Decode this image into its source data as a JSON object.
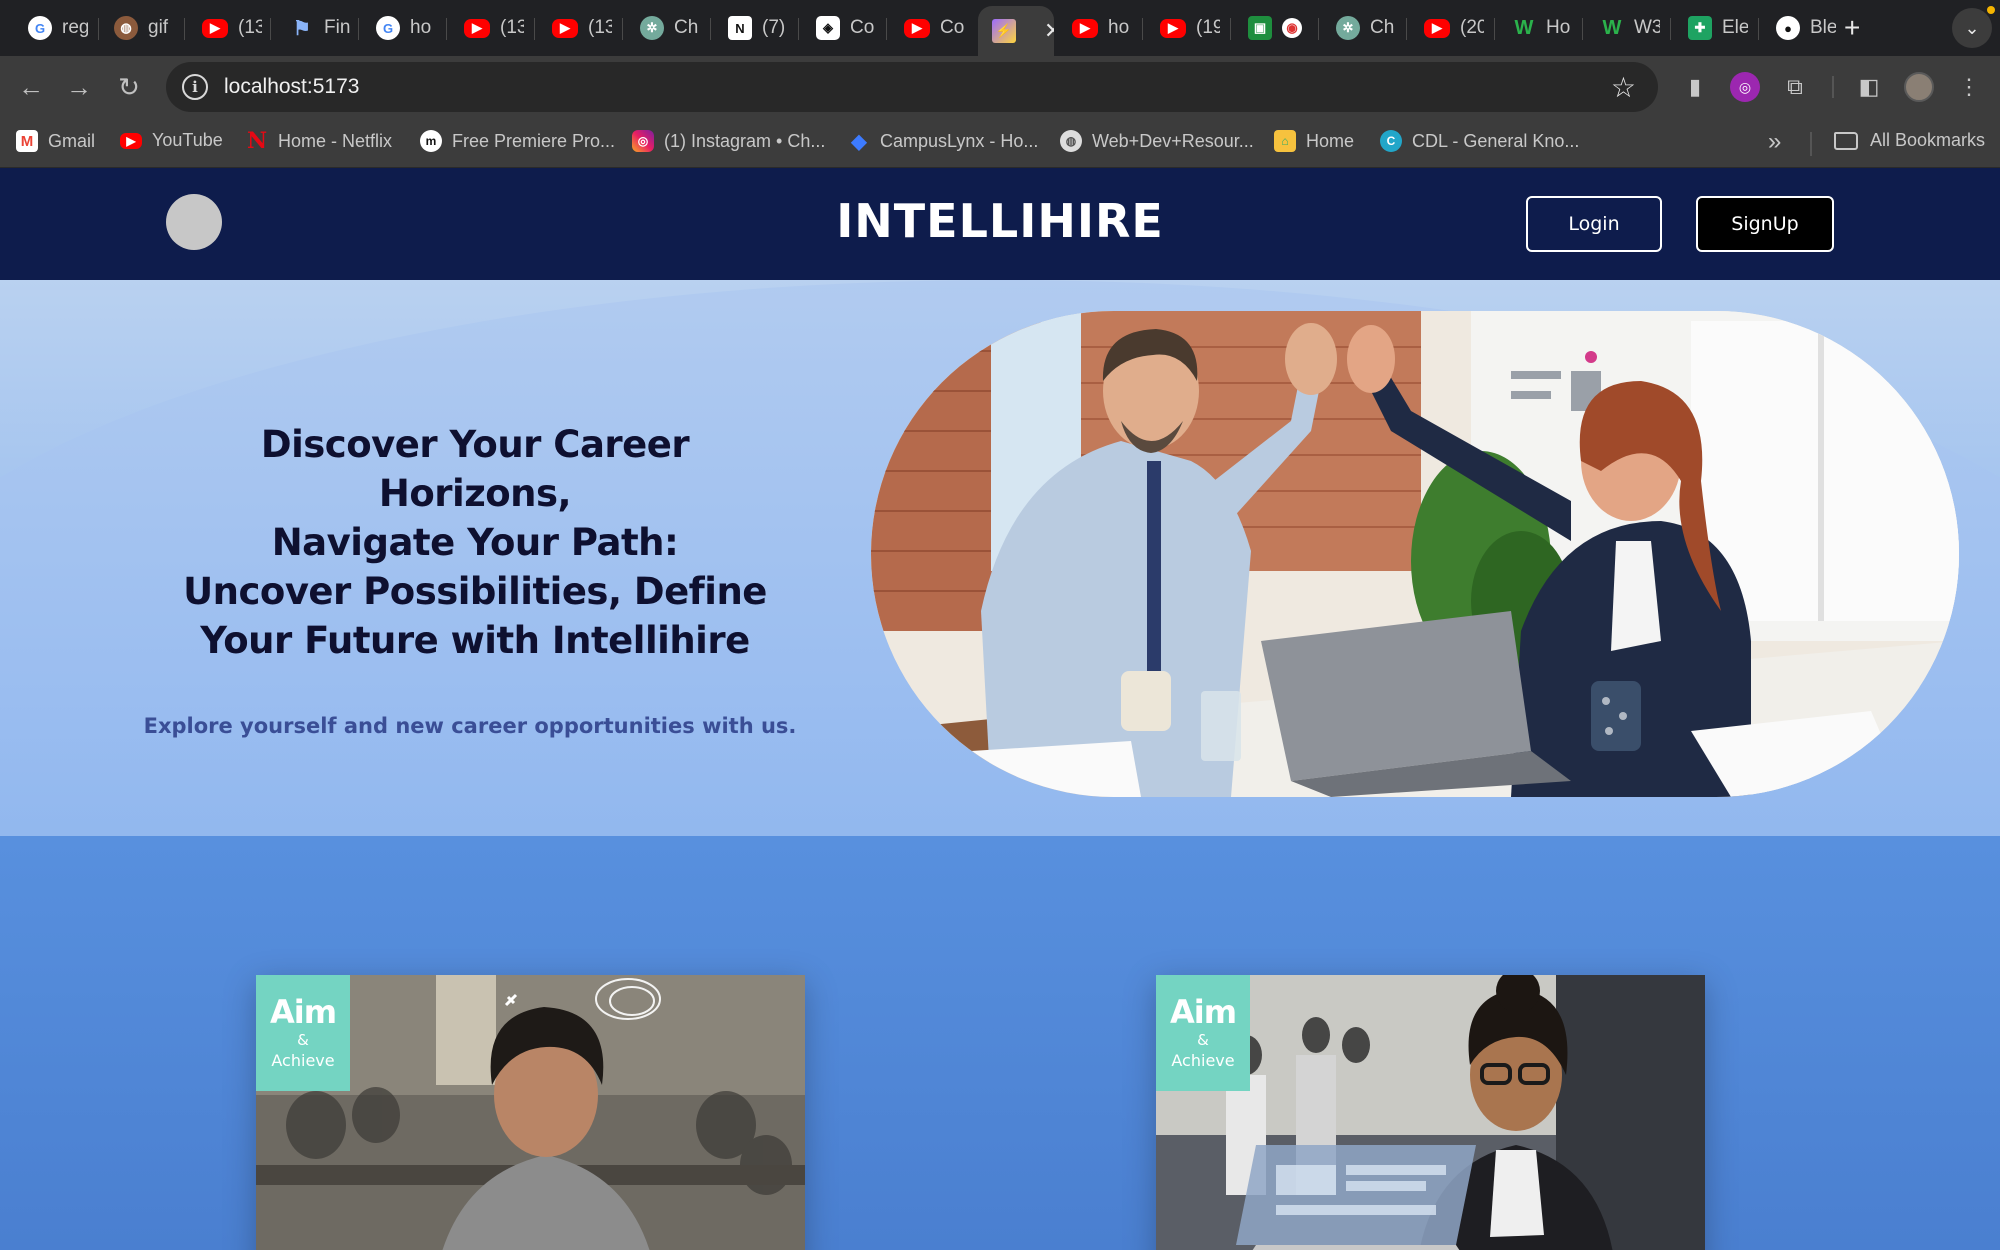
{
  "browser": {
    "tabs": [
      {
        "icon": "google-icon",
        "title": "reg"
      },
      {
        "icon": "globe-icon",
        "title": "gif"
      },
      {
        "icon": "youtube-icon",
        "title": "(13"
      },
      {
        "icon": "flag-icon",
        "title": "Fin"
      },
      {
        "icon": "google-icon",
        "title": "ho"
      },
      {
        "icon": "youtube-icon",
        "title": "(13"
      },
      {
        "icon": "youtube-icon",
        "title": "(13"
      },
      {
        "icon": "chatgpt-icon",
        "title": "Ch"
      },
      {
        "icon": "notion-icon",
        "title": "(7)"
      },
      {
        "icon": "codepen-icon",
        "title": "Co"
      },
      {
        "icon": "youtube-icon",
        "title": "Co"
      },
      {
        "icon": "vite-icon",
        "title": "",
        "active": true
      },
      {
        "icon": "youtube-icon",
        "title": "ho"
      },
      {
        "icon": "youtube-icon",
        "title": "(19"
      },
      {
        "icon": "meet-icon",
        "title": ""
      },
      {
        "icon": "chatgpt-icon",
        "title": "Ch"
      },
      {
        "icon": "youtube-icon",
        "title": "(20"
      },
      {
        "icon": "w3-icon",
        "title": "Ho"
      },
      {
        "icon": "w3-icon",
        "title": "W3"
      },
      {
        "icon": "sheets-icon",
        "title": "Ele"
      },
      {
        "icon": "medium-icon",
        "title": "Ble"
      }
    ],
    "address": "localhost:5173",
    "bookmarks": [
      {
        "icon": "gmail-icon",
        "label": "Gmail"
      },
      {
        "icon": "youtube-icon",
        "label": "YouTube"
      },
      {
        "icon": "netflix-icon",
        "label": "Home - Netflix"
      },
      {
        "icon": "m-icon",
        "label": "Free Premiere Pro..."
      },
      {
        "icon": "instagram-icon",
        "label": "(1) Instagram • Ch..."
      },
      {
        "icon": "campuslynx-icon",
        "label": "CampusLynx - Ho..."
      },
      {
        "icon": "globe-icon",
        "label": "Web+Dev+Resour..."
      },
      {
        "icon": "home-icon",
        "label": "Home"
      },
      {
        "icon": "cdl-icon",
        "label": "CDL - General Kno..."
      }
    ],
    "all_bookmarks": "All Bookmarks",
    "more_chevrons": "»"
  },
  "site": {
    "title": "INTELLIHIRE",
    "login_label": "Login",
    "signup_label": "SignUp",
    "hero": {
      "heading_lines": [
        "Discover Your Career Horizons,",
        "Navigate Your Path:",
        "Uncover Possibilities, Define",
        "Your Future with Intellihire"
      ],
      "subheading": "Explore yourself and new career opportunities with us."
    },
    "cards": [
      {
        "badge_title": "Aim",
        "badge_amp": "&",
        "badge_sub": "Achieve"
      },
      {
        "badge_title": "Aim",
        "badge_amp": "&",
        "badge_sub": "Achieve"
      }
    ]
  },
  "colors": {
    "header_bg": "#0e1c4c",
    "hero_bg": "#a4c4ef",
    "section_bg": "#5890de",
    "badge": "#74d4c2",
    "subheading": "#3a4e96"
  }
}
